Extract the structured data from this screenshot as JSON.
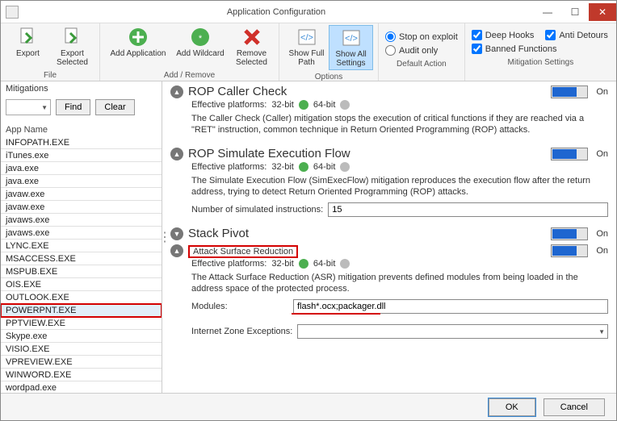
{
  "window": {
    "title": "Application Configuration",
    "min": "—",
    "max": "☐",
    "close": "✕"
  },
  "ribbon": {
    "groups": {
      "file": {
        "caption": "File",
        "export": "Export",
        "export_selected": "Export\nSelected"
      },
      "addremove": {
        "caption": "Add / Remove",
        "add_app": "Add Application",
        "add_wc": "Add Wildcard",
        "remove": "Remove\nSelected"
      },
      "options": {
        "caption": "Options",
        "fullpath": "Show Full\nPath",
        "showall": "Show All\nSettings"
      },
      "default": {
        "caption": "Default Action",
        "stop": "Stop on exploit",
        "audit": "Audit only"
      },
      "mitig": {
        "caption": "Mitigation Settings",
        "deep": "Deep Hooks",
        "anti": "Anti Detours",
        "banned": "Banned Functions"
      }
    }
  },
  "left": {
    "header": "Mitigations",
    "find": "Find",
    "clear": "Clear",
    "appname": "App Name",
    "apps": [
      "INFOPATH.EXE",
      "iTunes.exe",
      "java.exe",
      "java.exe",
      "javaw.exe",
      "javaw.exe",
      "javaws.exe",
      "javaws.exe",
      "LYNC.EXE",
      "MSACCESS.EXE",
      "MSPUB.EXE",
      "OIS.EXE",
      "OUTLOOK.EXE",
      "POWERPNT.EXE",
      "PPTVIEW.EXE",
      "Skype.exe",
      "VISIO.EXE",
      "VPREVIEW.EXE",
      "WINWORD.EXE",
      "wordpad.exe"
    ],
    "selected_index": 13
  },
  "mitigations": {
    "rop_caller": {
      "title": "ROP Caller Check",
      "toggle": "On",
      "eff_label": "Effective platforms:",
      "p32": "32-bit",
      "p64": "64-bit",
      "desc": "The Caller Check (Caller) mitigation stops the execution of critical functions if they are reached via a \"RET\" instruction, common technique in Return Oriented Programming (ROP) attacks."
    },
    "rop_sim": {
      "title": "ROP Simulate Execution Flow",
      "toggle": "On",
      "eff_label": "Effective platforms:",
      "p32": "32-bit",
      "p64": "64-bit",
      "desc": "The Simulate Execution Flow (SimExecFlow) mitigation reproduces the execution flow after the return address, trying to detect Return Oriented Programming (ROP) attacks.",
      "numlabel": "Number of simulated instructions:",
      "numval": "15"
    },
    "stack_pivot": {
      "title": "Stack Pivot",
      "toggle": "On"
    },
    "asr": {
      "title": "Attack Surface Reduction",
      "toggle": "On",
      "eff_label": "Effective platforms:",
      "p32": "32-bit",
      "p64": "64-bit",
      "desc": "The Attack Surface Reduction (ASR) mitigation prevents defined modules from being loaded in the address space of the protected process.",
      "modlabel": "Modules:",
      "modval": "flash*.ocx;packager.dll",
      "izlabel": "Internet Zone Exceptions:"
    }
  },
  "footer": {
    "ok": "OK",
    "cancel": "Cancel"
  }
}
